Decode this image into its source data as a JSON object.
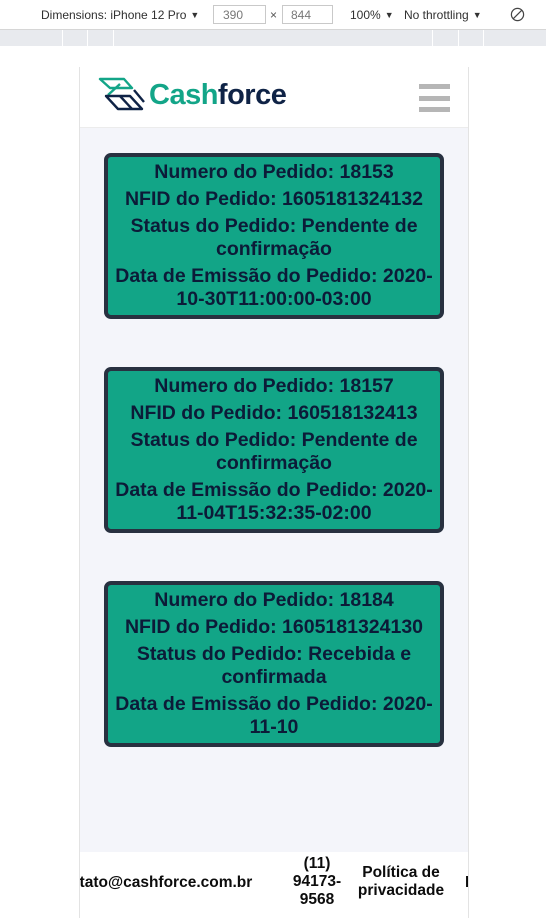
{
  "devtools": {
    "dimensions_label": "Dimensions: iPhone 12 Pro",
    "width_value": "390",
    "times": "×",
    "height_value": "844",
    "zoom": "100%",
    "throttling": "No throttling"
  },
  "brand": {
    "name_part1": "Cash",
    "name_part2": "force",
    "accent_color": "#13a588",
    "dark_color": "#0f2346"
  },
  "orders": [
    {
      "numero": "Numero do Pedido: 18153",
      "nfid": "NFID do Pedido: 1605181324132",
      "status": "Status do Pedido: Pendente de confirmação",
      "data": "Data de Emissão do Pedido: 2020-10-30T11:00:00-03:00"
    },
    {
      "numero": "Numero do Pedido: 18157",
      "nfid": "NFID do Pedido: 160518132413",
      "status": "Status do Pedido: Pendente de confirmação",
      "data": "Data de Emissão do Pedido: 2020-11-04T15:32:35-02:00"
    },
    {
      "numero": "Numero do Pedido: 18184",
      "nfid": "NFID do Pedido: 1605181324130",
      "status": "Status do Pedido: Recebida e confirmada",
      "data": "Data de Emissão do Pedido: 2020-11-10"
    }
  ],
  "footer": {
    "email": "contato@cashforce.com.br",
    "phone": "(11) 94173-9568",
    "policy": "Política de privacidade",
    "more": "L"
  }
}
